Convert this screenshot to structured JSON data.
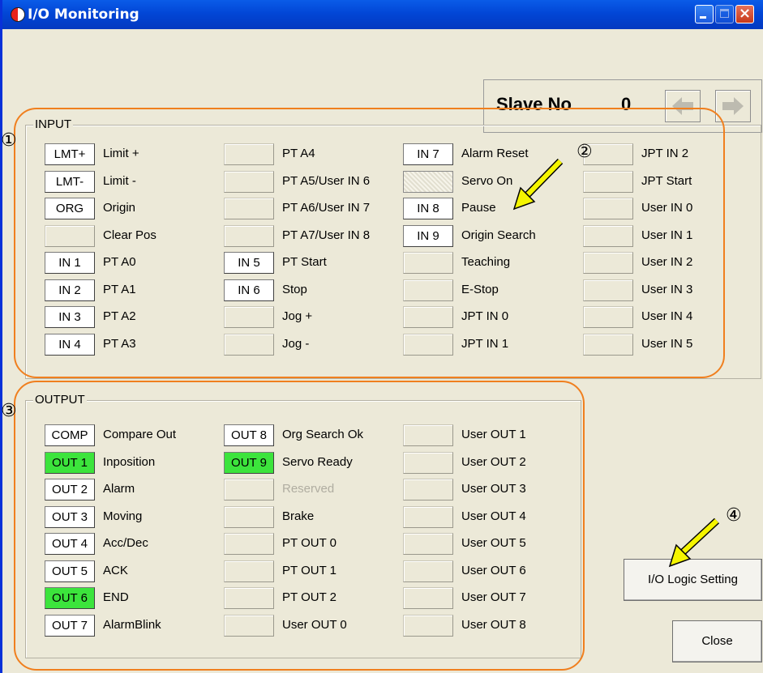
{
  "window": {
    "title": "I/O Monitoring"
  },
  "slave": {
    "label": "Slave No",
    "value": "0"
  },
  "input_group": {
    "title": "INPUT",
    "columns": [
      {
        "items": [
          {
            "indicator": "LMT+",
            "state": "white",
            "label": "Limit +"
          },
          {
            "indicator": "LMT-",
            "state": "white",
            "label": "Limit -"
          },
          {
            "indicator": "ORG",
            "state": "white",
            "label": "Origin"
          },
          {
            "indicator": "",
            "state": "off",
            "label": "Clear Pos"
          },
          {
            "indicator": "IN 1",
            "state": "white",
            "label": "PT A0"
          },
          {
            "indicator": "IN 2",
            "state": "white",
            "label": "PT A1"
          },
          {
            "indicator": "IN 3",
            "state": "white",
            "label": "PT A2"
          },
          {
            "indicator": "IN 4",
            "state": "white",
            "label": "PT A3"
          }
        ]
      },
      {
        "items": [
          {
            "indicator": "",
            "state": "off",
            "label": "PT A4"
          },
          {
            "indicator": "",
            "state": "off",
            "label": "PT A5/User IN 6"
          },
          {
            "indicator": "",
            "state": "off",
            "label": "PT A6/User IN 7"
          },
          {
            "indicator": "",
            "state": "off",
            "label": "PT A7/User IN 8"
          },
          {
            "indicator": "IN 5",
            "state": "white",
            "label": "PT Start"
          },
          {
            "indicator": "IN 6",
            "state": "white",
            "label": "Stop"
          },
          {
            "indicator": "",
            "state": "off",
            "label": "Jog +"
          },
          {
            "indicator": "",
            "state": "off",
            "label": "Jog -"
          }
        ]
      },
      {
        "items": [
          {
            "indicator": "IN 7",
            "state": "white",
            "label": "Alarm Reset"
          },
          {
            "indicator": "",
            "state": "disabled",
            "label": "Servo On"
          },
          {
            "indicator": "IN 8",
            "state": "white",
            "label": "Pause"
          },
          {
            "indicator": "IN 9",
            "state": "white",
            "label": "Origin Search"
          },
          {
            "indicator": "",
            "state": "off",
            "label": "Teaching"
          },
          {
            "indicator": "",
            "state": "off",
            "label": "E-Stop"
          },
          {
            "indicator": "",
            "state": "off",
            "label": "JPT IN 0"
          },
          {
            "indicator": "",
            "state": "off",
            "label": "JPT IN 1"
          }
        ]
      },
      {
        "items": [
          {
            "indicator": "",
            "state": "off",
            "label": "JPT IN 2"
          },
          {
            "indicator": "",
            "state": "off",
            "label": "JPT Start"
          },
          {
            "indicator": "",
            "state": "off",
            "label": "User IN 0"
          },
          {
            "indicator": "",
            "state": "off",
            "label": "User IN 1"
          },
          {
            "indicator": "",
            "state": "off",
            "label": "User IN 2"
          },
          {
            "indicator": "",
            "state": "off",
            "label": "User IN 3"
          },
          {
            "indicator": "",
            "state": "off",
            "label": "User IN 4"
          },
          {
            "indicator": "",
            "state": "off",
            "label": "User IN 5"
          }
        ]
      }
    ]
  },
  "output_group": {
    "title": "OUTPUT",
    "columns": [
      {
        "items": [
          {
            "indicator": "COMP",
            "state": "white",
            "label": "Compare Out"
          },
          {
            "indicator": "OUT 1",
            "state": "on",
            "label": "Inposition"
          },
          {
            "indicator": "OUT 2",
            "state": "white",
            "label": "Alarm"
          },
          {
            "indicator": "OUT 3",
            "state": "white",
            "label": "Moving"
          },
          {
            "indicator": "OUT 4",
            "state": "white",
            "label": "Acc/Dec"
          },
          {
            "indicator": "OUT 5",
            "state": "white",
            "label": "ACK"
          },
          {
            "indicator": "OUT 6",
            "state": "on",
            "label": "END"
          },
          {
            "indicator": "OUT 7",
            "state": "white",
            "label": "AlarmBlink"
          }
        ]
      },
      {
        "items": [
          {
            "indicator": "OUT 8",
            "state": "white",
            "label": "Org Search Ok"
          },
          {
            "indicator": "OUT 9",
            "state": "on",
            "label": "Servo Ready"
          },
          {
            "indicator": "",
            "state": "off",
            "label": "Reserved",
            "gray": true
          },
          {
            "indicator": "",
            "state": "off",
            "label": "Brake"
          },
          {
            "indicator": "",
            "state": "off",
            "label": "PT OUT 0"
          },
          {
            "indicator": "",
            "state": "off",
            "label": "PT OUT 1"
          },
          {
            "indicator": "",
            "state": "off",
            "label": "PT OUT 2"
          },
          {
            "indicator": "",
            "state": "off",
            "label": "User OUT 0"
          }
        ]
      },
      {
        "items": [
          {
            "indicator": "",
            "state": "off",
            "label": "User OUT 1"
          },
          {
            "indicator": "",
            "state": "off",
            "label": "User OUT 2"
          },
          {
            "indicator": "",
            "state": "off",
            "label": "User OUT 3"
          },
          {
            "indicator": "",
            "state": "off",
            "label": "User OUT 4"
          },
          {
            "indicator": "",
            "state": "off",
            "label": "User OUT 5"
          },
          {
            "indicator": "",
            "state": "off",
            "label": "User OUT 6"
          },
          {
            "indicator": "",
            "state": "off",
            "label": "User OUT 7"
          },
          {
            "indicator": "",
            "state": "off",
            "label": "User OUT 8"
          }
        ]
      }
    ]
  },
  "buttons": {
    "logic": "I/O Logic Setting",
    "close": "Close"
  },
  "callouts": {
    "n1": "①",
    "n2": "②",
    "n3": "③",
    "n4": "④"
  },
  "colors": {
    "on": "#3ce43c",
    "callout": "#f07f1e",
    "pointer": "#f5f500",
    "titlebar": "#0246d6"
  },
  "icons": {
    "prev": "left-arrow-icon",
    "next": "right-arrow-icon",
    "app": "app-icon"
  }
}
